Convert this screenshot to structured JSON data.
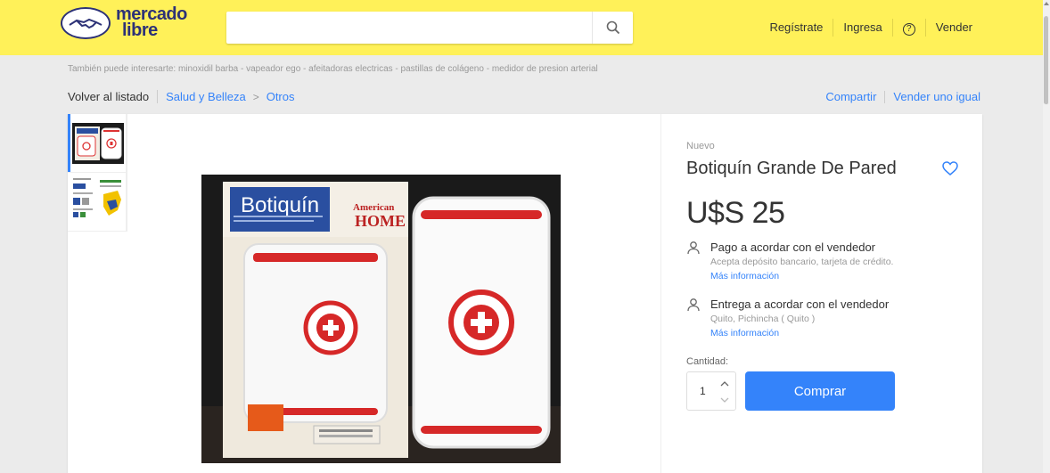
{
  "header": {
    "logo": {
      "line1": "mercado",
      "line2": "libre"
    },
    "search": {
      "placeholder": ""
    },
    "nav": {
      "register": "Regístrate",
      "login": "Ingresa",
      "help": "?",
      "sell": "Vender"
    }
  },
  "related_searches": "También puede interesarte: minoxidil barba - vapeador ego - afeitadoras electricas - pastillas de colágeno - medidor de presion arterial",
  "breadcrumb": {
    "back": "Volver al listado",
    "path": [
      "Salud y Belleza",
      "Otros"
    ],
    "separator": ">"
  },
  "actions": {
    "share": "Compartir",
    "sell_same": "Vender uno igual"
  },
  "gallery": {
    "box": {
      "brand_title": "Botiquín",
      "brand_logo_line1": "American",
      "brand_logo_line2": "HOME"
    }
  },
  "product": {
    "condition": "Nuevo",
    "title": "Botiquín Grande De Pared",
    "price": "U$S 25",
    "payment": {
      "title": "Pago a acordar con el vendedor",
      "detail": "Acepta depósito bancario, tarjeta de crédito.",
      "more": "Más información"
    },
    "delivery": {
      "title": "Entrega a acordar con el vendedor",
      "detail": "Quito, Pichincha ( Quito )",
      "more": "Más información"
    },
    "quantity_label": "Cantidad:",
    "quantity": "1",
    "buy_label": "Comprar"
  },
  "colors": {
    "header_bg": "#fff159",
    "accent": "#3483fa",
    "logo_blue": "#2d3277"
  }
}
